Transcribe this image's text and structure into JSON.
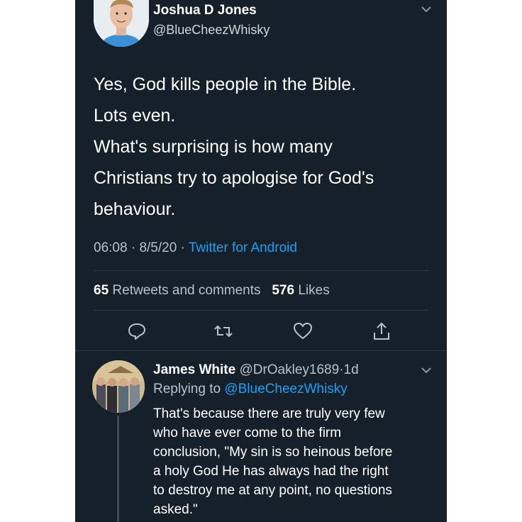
{
  "tweet": {
    "author_name": "Joshua D Jones",
    "author_handle": "@BlueCheezWhisky",
    "lines": [
      "Yes, God kills people in the Bible.",
      "Lots even.",
      "What's surprising is how many",
      "Christians try to apologise for God's",
      "behaviour."
    ],
    "time": "06:08",
    "date": "8/5/20",
    "source": "Twitter for Android",
    "retweets_count": "65",
    "retweets_label": "Retweets and comments",
    "likes_count": "576",
    "likes_label": "Likes"
  },
  "actions": [
    "reply-icon",
    "retweet-icon",
    "like-icon",
    "share-icon"
  ],
  "reply": {
    "author_name": "James White",
    "author_handle": "@DrOakley1689",
    "age": "1d",
    "replying_label": "Replying to",
    "replying_handle": "@BlueCheezWhisky",
    "lines": [
      "That's because there are truly very few",
      "who have ever come to the firm",
      "conclusion, \"My sin is so heinous before",
      "a holy God He has always had the right",
      "to destroy me at any point, no questions",
      "asked.\""
    ]
  },
  "colors": {
    "background": "#15202b",
    "accent": "#1da1f2",
    "secondary_text": "#b9c2cb",
    "divider": "#2f3d4a"
  }
}
